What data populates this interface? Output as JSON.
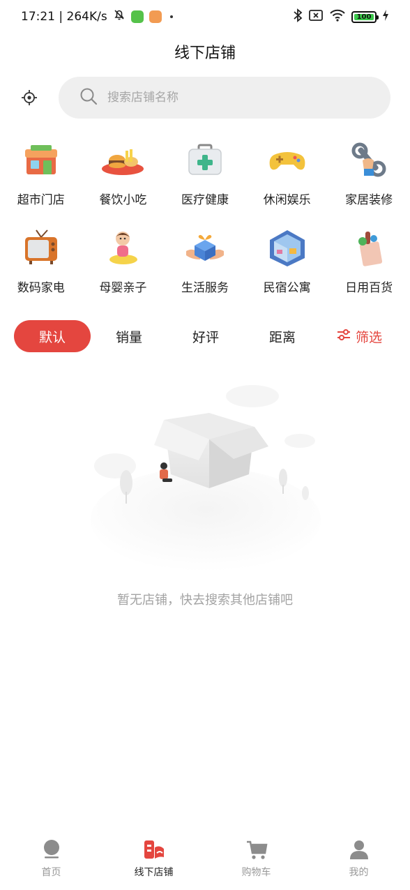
{
  "status_bar": {
    "time_speed": "17:21 | 264K/s",
    "battery": "100"
  },
  "header": {
    "title": "线下店铺"
  },
  "search": {
    "placeholder": "搜索店铺名称"
  },
  "categories": [
    {
      "label": "超市门店",
      "icon": "supermarket-icon"
    },
    {
      "label": "餐饮小吃",
      "icon": "food-icon"
    },
    {
      "label": "医疗健康",
      "icon": "medical-kit-icon"
    },
    {
      "label": "休闲娱乐",
      "icon": "gamepad-icon"
    },
    {
      "label": "家居装修",
      "icon": "wrench-icon"
    },
    {
      "label": "数码家电",
      "icon": "tv-icon"
    },
    {
      "label": "母婴亲子",
      "icon": "baby-icon"
    },
    {
      "label": "生活服务",
      "icon": "gift-hands-icon"
    },
    {
      "label": "民宿公寓",
      "icon": "room-icon"
    },
    {
      "label": "日用百货",
      "icon": "grocery-bag-icon"
    }
  ],
  "sort": {
    "default": "默认",
    "sales": "销量",
    "rating": "好评",
    "distance": "距离",
    "filter": "筛选"
  },
  "empty": {
    "message": "暂无店铺，快去搜索其他店铺吧"
  },
  "bottom_nav": {
    "home": "首页",
    "stores": "线下店铺",
    "cart": "购物车",
    "mine": "我的"
  },
  "colors": {
    "accent": "#e4463f",
    "search_bg": "#efefef"
  }
}
